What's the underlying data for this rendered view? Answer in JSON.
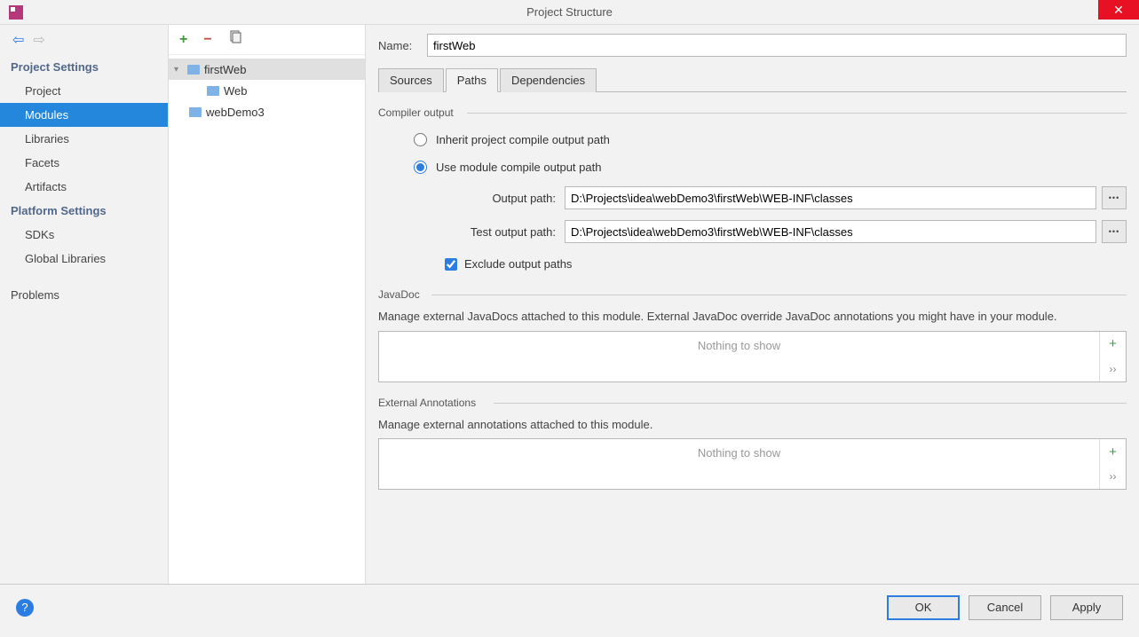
{
  "window": {
    "title": "Project Structure"
  },
  "sidebar": {
    "section1": "Project Settings",
    "items1": [
      "Project",
      "Modules",
      "Libraries",
      "Facets",
      "Artifacts"
    ],
    "section2": "Platform Settings",
    "items2": [
      "SDKs",
      "Global Libraries"
    ],
    "problems": "Problems",
    "selected": "Modules"
  },
  "tree": {
    "nodes": [
      {
        "label": "firstWeb",
        "level": 0,
        "expanded": true,
        "selected": true
      },
      {
        "label": "Web",
        "level": 1
      },
      {
        "label": "webDemo3",
        "level": 0
      }
    ]
  },
  "content": {
    "name_label": "Name:",
    "name_value": "firstWeb",
    "tabs": [
      "Sources",
      "Paths",
      "Dependencies"
    ],
    "active_tab": "Paths",
    "compiler_output": {
      "group": "Compiler output",
      "radio1": "Inherit project compile output path",
      "radio2": "Use module compile output path",
      "selected": "module",
      "output_label": "Output path:",
      "output_value": "D:\\Projects\\idea\\webDemo3\\firstWeb\\WEB-INF\\classes",
      "test_label": "Test output path:",
      "test_value": "D:\\Projects\\idea\\webDemo3\\firstWeb\\WEB-INF\\classes",
      "exclude_label": "Exclude output paths",
      "exclude_checked": true
    },
    "javadoc": {
      "group": "JavaDoc",
      "desc": "Manage external JavaDocs attached to this module. External JavaDoc override JavaDoc annotations you might have in your module.",
      "empty": "Nothing to show"
    },
    "annotations": {
      "group": "External Annotations",
      "desc": "Manage external annotations attached to this module.",
      "empty": "Nothing to show"
    }
  },
  "footer": {
    "ok": "OK",
    "cancel": "Cancel",
    "apply": "Apply"
  }
}
